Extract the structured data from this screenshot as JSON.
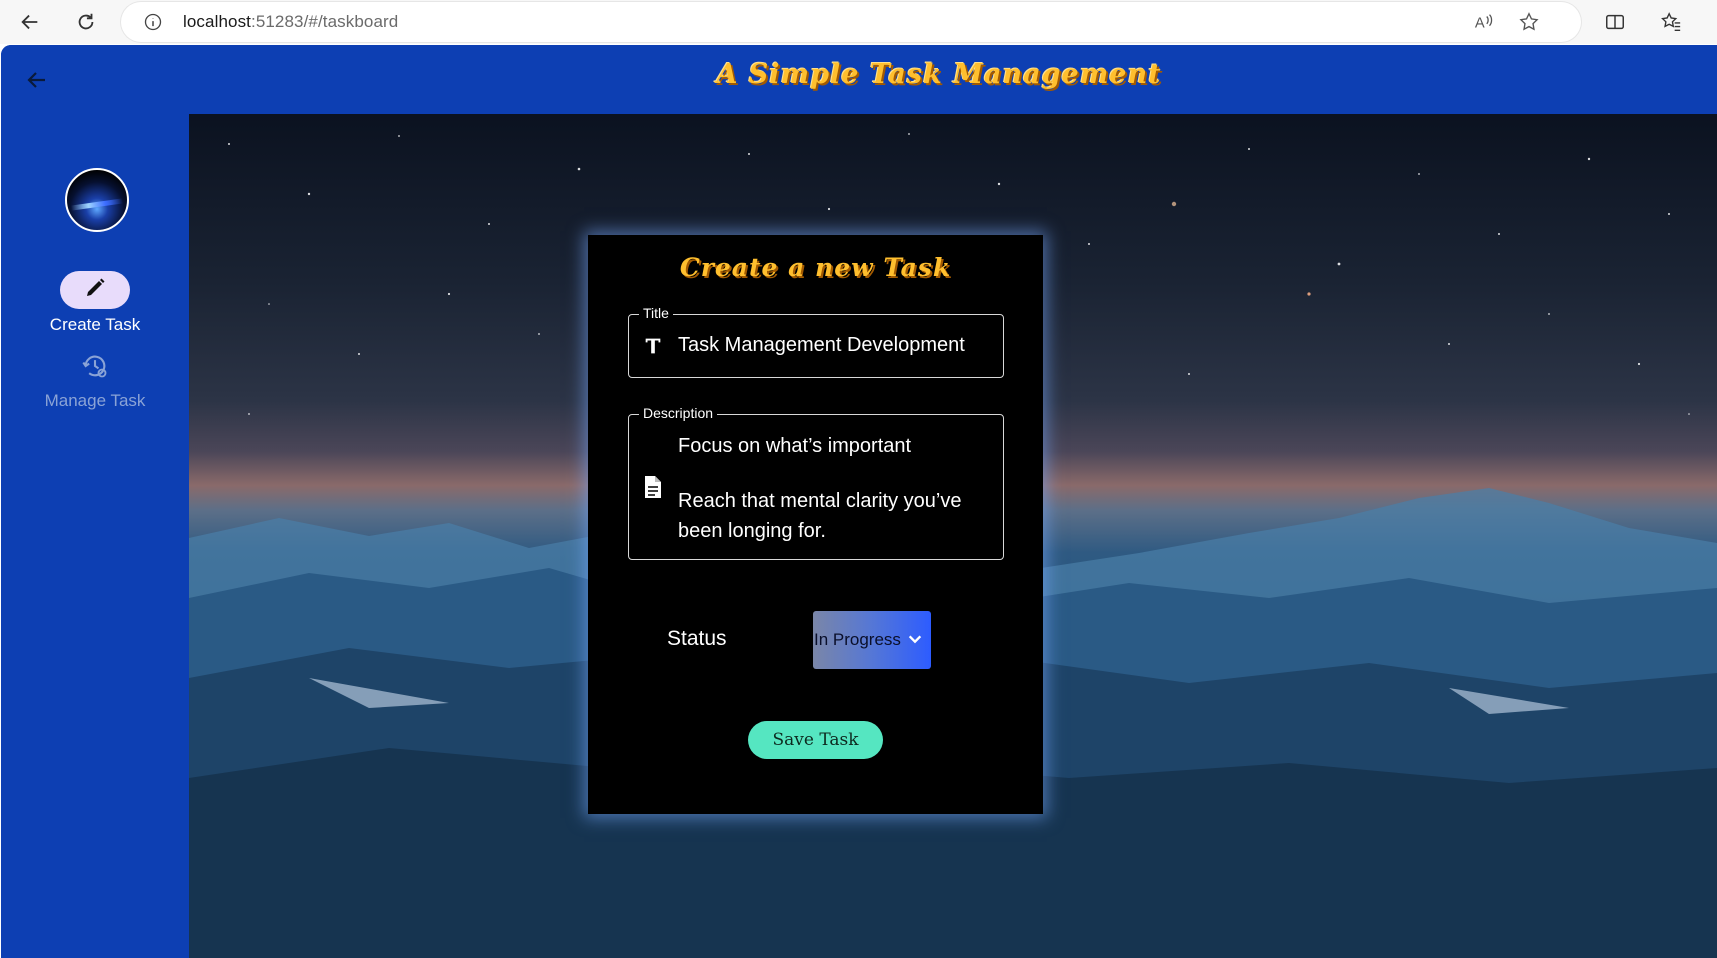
{
  "browser": {
    "url_host": "localhost",
    "url_rest": ":51283/#/taskboard",
    "icons": [
      "back-icon",
      "refresh-icon",
      "info-icon",
      "read-aloud-icon",
      "favorite-star-icon",
      "split-screen-icon",
      "favorites-icon"
    ]
  },
  "app": {
    "title": "A Simple Task Management"
  },
  "sidebar": {
    "items": [
      {
        "label": "Create Task",
        "icon": "pencil-icon",
        "active": true
      },
      {
        "label": "Manage Task",
        "icon": "manage-history-icon",
        "active": false
      }
    ]
  },
  "form": {
    "heading": "Create a new Task",
    "title_field": {
      "legend": "Title",
      "value": "Task Management Development"
    },
    "description_field": {
      "legend": "Description",
      "line1": "Focus on what’s important",
      "line2": "Reach that mental clarity you’ve been longing for."
    },
    "status": {
      "label": "Status",
      "selected": "In Progress"
    },
    "save_label": "Save Task"
  },
  "colors": {
    "app_blue": "#0d3fb3",
    "title_gold": "#ffbf2e",
    "save_green": "#55e6c1",
    "card_bg": "#000000"
  }
}
